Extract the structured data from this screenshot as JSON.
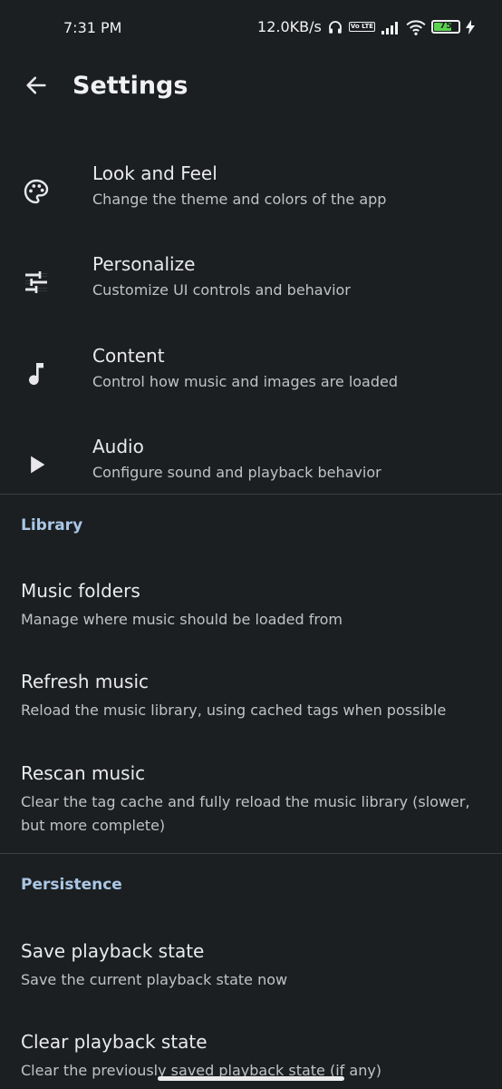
{
  "status_bar": {
    "time": "7:31 PM",
    "network_speed": "12.0KB/s",
    "volte_badge": "Vo LTE",
    "battery_level": "75",
    "battery_fraction": 0.75,
    "icons": [
      "headphones-icon",
      "volte-icon",
      "signal-icon",
      "wifi-icon",
      "battery-icon",
      "charging-icon"
    ]
  },
  "toolbar": {
    "title": "Settings",
    "back_icon": "arrow-back-icon"
  },
  "main_items": [
    {
      "icon": "palette-icon",
      "label": "Look and Feel",
      "sub": "Change the theme and colors of the app"
    },
    {
      "icon": "tune-icon",
      "label": "Personalize",
      "sub": "Customize UI controls and behavior"
    },
    {
      "icon": "music-note-icon",
      "label": "Content",
      "sub": "Control how music and images are loaded"
    },
    {
      "icon": "play-icon",
      "label": "Audio",
      "sub": "Configure sound and playback behavior"
    }
  ],
  "library": {
    "header": "Library",
    "items": [
      {
        "label": "Music folders",
        "sub": "Manage where music should be loaded from"
      },
      {
        "label": "Refresh music",
        "sub": "Reload the music library, using cached tags when possible"
      },
      {
        "label": "Rescan music",
        "sub": "Clear the tag cache and fully reload the music library (slower, but more complete)"
      }
    ]
  },
  "persistence": {
    "header": "Persistence",
    "items": [
      {
        "label": "Save playback state",
        "sub": "Save the current playback state now"
      },
      {
        "label": "Clear playback state",
        "sub": "Clear the previously saved playback state (if any)"
      }
    ]
  },
  "colors": {
    "background": "#1c1f22",
    "section_header": "#a9c7e5",
    "battery": "#5bd34f"
  }
}
